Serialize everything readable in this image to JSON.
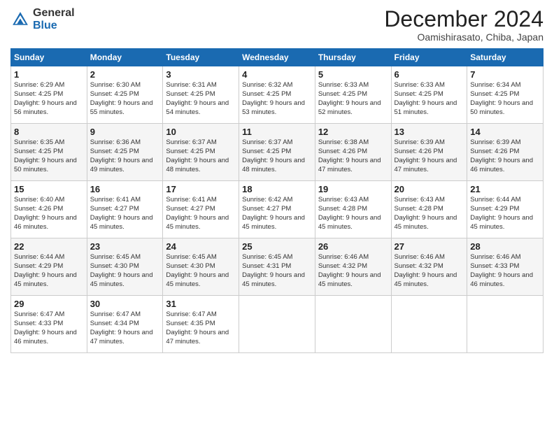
{
  "header": {
    "logo_general": "General",
    "logo_blue": "Blue",
    "month_title": "December 2024",
    "location": "Oamishirasato, Chiba, Japan"
  },
  "calendar": {
    "days_of_week": [
      "Sunday",
      "Monday",
      "Tuesday",
      "Wednesday",
      "Thursday",
      "Friday",
      "Saturday"
    ],
    "weeks": [
      [
        null,
        null,
        null,
        null,
        null,
        null,
        null
      ]
    ],
    "cells": [
      {
        "day": null,
        "sunrise": null,
        "sunset": null,
        "daylight": null
      },
      {
        "day": null,
        "sunrise": null,
        "sunset": null,
        "daylight": null
      },
      {
        "day": null,
        "sunrise": null,
        "sunset": null,
        "daylight": null
      },
      {
        "day": null,
        "sunrise": null,
        "sunset": null,
        "daylight": null
      },
      {
        "day": null,
        "sunrise": null,
        "sunset": null,
        "daylight": null
      },
      {
        "day": null,
        "sunrise": null,
        "sunset": null,
        "daylight": null
      },
      {
        "day": null,
        "sunrise": null,
        "sunset": null,
        "daylight": null
      }
    ]
  },
  "days": [
    {
      "num": "1",
      "sunrise": "Sunrise: 6:29 AM",
      "sunset": "Sunset: 4:25 PM",
      "daylight": "Daylight: 9 hours and 56 minutes."
    },
    {
      "num": "2",
      "sunrise": "Sunrise: 6:30 AM",
      "sunset": "Sunset: 4:25 PM",
      "daylight": "Daylight: 9 hours and 55 minutes."
    },
    {
      "num": "3",
      "sunrise": "Sunrise: 6:31 AM",
      "sunset": "Sunset: 4:25 PM",
      "daylight": "Daylight: 9 hours and 54 minutes."
    },
    {
      "num": "4",
      "sunrise": "Sunrise: 6:32 AM",
      "sunset": "Sunset: 4:25 PM",
      "daylight": "Daylight: 9 hours and 53 minutes."
    },
    {
      "num": "5",
      "sunrise": "Sunrise: 6:33 AM",
      "sunset": "Sunset: 4:25 PM",
      "daylight": "Daylight: 9 hours and 52 minutes."
    },
    {
      "num": "6",
      "sunrise": "Sunrise: 6:33 AM",
      "sunset": "Sunset: 4:25 PM",
      "daylight": "Daylight: 9 hours and 51 minutes."
    },
    {
      "num": "7",
      "sunrise": "Sunrise: 6:34 AM",
      "sunset": "Sunset: 4:25 PM",
      "daylight": "Daylight: 9 hours and 50 minutes."
    },
    {
      "num": "8",
      "sunrise": "Sunrise: 6:35 AM",
      "sunset": "Sunset: 4:25 PM",
      "daylight": "Daylight: 9 hours and 50 minutes."
    },
    {
      "num": "9",
      "sunrise": "Sunrise: 6:36 AM",
      "sunset": "Sunset: 4:25 PM",
      "daylight": "Daylight: 9 hours and 49 minutes."
    },
    {
      "num": "10",
      "sunrise": "Sunrise: 6:37 AM",
      "sunset": "Sunset: 4:25 PM",
      "daylight": "Daylight: 9 hours and 48 minutes."
    },
    {
      "num": "11",
      "sunrise": "Sunrise: 6:37 AM",
      "sunset": "Sunset: 4:25 PM",
      "daylight": "Daylight: 9 hours and 48 minutes."
    },
    {
      "num": "12",
      "sunrise": "Sunrise: 6:38 AM",
      "sunset": "Sunset: 4:26 PM",
      "daylight": "Daylight: 9 hours and 47 minutes."
    },
    {
      "num": "13",
      "sunrise": "Sunrise: 6:39 AM",
      "sunset": "Sunset: 4:26 PM",
      "daylight": "Daylight: 9 hours and 47 minutes."
    },
    {
      "num": "14",
      "sunrise": "Sunrise: 6:39 AM",
      "sunset": "Sunset: 4:26 PM",
      "daylight": "Daylight: 9 hours and 46 minutes."
    },
    {
      "num": "15",
      "sunrise": "Sunrise: 6:40 AM",
      "sunset": "Sunset: 4:26 PM",
      "daylight": "Daylight: 9 hours and 46 minutes."
    },
    {
      "num": "16",
      "sunrise": "Sunrise: 6:41 AM",
      "sunset": "Sunset: 4:27 PM",
      "daylight": "Daylight: 9 hours and 45 minutes."
    },
    {
      "num": "17",
      "sunrise": "Sunrise: 6:41 AM",
      "sunset": "Sunset: 4:27 PM",
      "daylight": "Daylight: 9 hours and 45 minutes."
    },
    {
      "num": "18",
      "sunrise": "Sunrise: 6:42 AM",
      "sunset": "Sunset: 4:27 PM",
      "daylight": "Daylight: 9 hours and 45 minutes."
    },
    {
      "num": "19",
      "sunrise": "Sunrise: 6:43 AM",
      "sunset": "Sunset: 4:28 PM",
      "daylight": "Daylight: 9 hours and 45 minutes."
    },
    {
      "num": "20",
      "sunrise": "Sunrise: 6:43 AM",
      "sunset": "Sunset: 4:28 PM",
      "daylight": "Daylight: 9 hours and 45 minutes."
    },
    {
      "num": "21",
      "sunrise": "Sunrise: 6:44 AM",
      "sunset": "Sunset: 4:29 PM",
      "daylight": "Daylight: 9 hours and 45 minutes."
    },
    {
      "num": "22",
      "sunrise": "Sunrise: 6:44 AM",
      "sunset": "Sunset: 4:29 PM",
      "daylight": "Daylight: 9 hours and 45 minutes."
    },
    {
      "num": "23",
      "sunrise": "Sunrise: 6:45 AM",
      "sunset": "Sunset: 4:30 PM",
      "daylight": "Daylight: 9 hours and 45 minutes."
    },
    {
      "num": "24",
      "sunrise": "Sunrise: 6:45 AM",
      "sunset": "Sunset: 4:30 PM",
      "daylight": "Daylight: 9 hours and 45 minutes."
    },
    {
      "num": "25",
      "sunrise": "Sunrise: 6:45 AM",
      "sunset": "Sunset: 4:31 PM",
      "daylight": "Daylight: 9 hours and 45 minutes."
    },
    {
      "num": "26",
      "sunrise": "Sunrise: 6:46 AM",
      "sunset": "Sunset: 4:32 PM",
      "daylight": "Daylight: 9 hours and 45 minutes."
    },
    {
      "num": "27",
      "sunrise": "Sunrise: 6:46 AM",
      "sunset": "Sunset: 4:32 PM",
      "daylight": "Daylight: 9 hours and 45 minutes."
    },
    {
      "num": "28",
      "sunrise": "Sunrise: 6:46 AM",
      "sunset": "Sunset: 4:33 PM",
      "daylight": "Daylight: 9 hours and 46 minutes."
    },
    {
      "num": "29",
      "sunrise": "Sunrise: 6:47 AM",
      "sunset": "Sunset: 4:33 PM",
      "daylight": "Daylight: 9 hours and 46 minutes."
    },
    {
      "num": "30",
      "sunrise": "Sunrise: 6:47 AM",
      "sunset": "Sunset: 4:34 PM",
      "daylight": "Daylight: 9 hours and 47 minutes."
    },
    {
      "num": "31",
      "sunrise": "Sunrise: 6:47 AM",
      "sunset": "Sunset: 4:35 PM",
      "daylight": "Daylight: 9 hours and 47 minutes."
    }
  ],
  "dow": [
    "Sunday",
    "Monday",
    "Tuesday",
    "Wednesday",
    "Thursday",
    "Friday",
    "Saturday"
  ]
}
